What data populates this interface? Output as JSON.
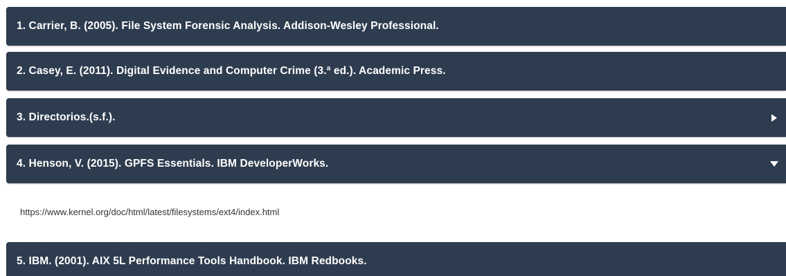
{
  "accordion": {
    "items": [
      {
        "label": "1. Carrier, B. (2005). File System Forensic Analysis. Addison-Wesley Professional.",
        "state": "collapsed"
      },
      {
        "label": "2. Casey, E. (2011). Digital Evidence and Computer Crime (3.ª ed.). Academic Press.",
        "state": "collapsed"
      },
      {
        "label": "3. Directorios.(s.f.).",
        "state": "collapsed",
        "icon": "caret-right-icon"
      },
      {
        "label": "4. Henson, V. (2015). GPFS Essentials. IBM DeveloperWorks.",
        "state": "expanded",
        "icon": "caret-down-icon",
        "content": "https://www.kernel.org/doc/html/latest/filesystems/ext4/index.html"
      },
      {
        "label": "5. IBM. (2001). AIX 5L Performance Tools Handbook. IBM Redbooks.",
        "state": "collapsed"
      }
    ]
  },
  "colors": {
    "header_bg": "#2e3c4f",
    "header_text": "#ffffff",
    "content_text": "#333333",
    "page_bg": "#ffffff"
  }
}
